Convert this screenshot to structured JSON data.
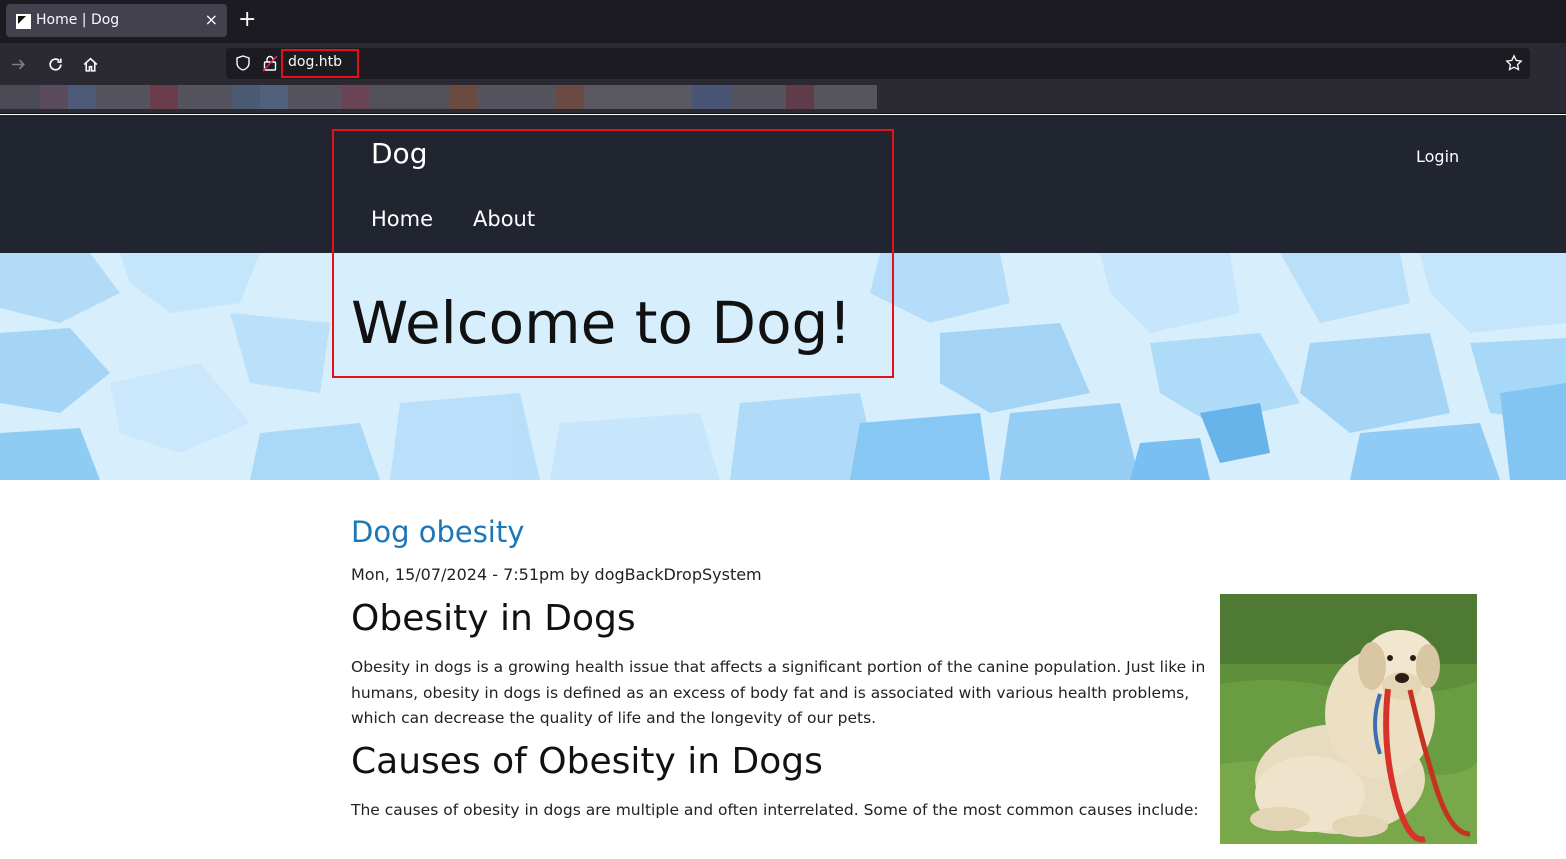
{
  "browser": {
    "tab_title": "Home | Dog",
    "tab_close": "×",
    "new_tab": "+",
    "url": "dog.htb"
  },
  "site": {
    "name": "Dog",
    "nav": {
      "home": "Home",
      "about": "About"
    },
    "login": "Login"
  },
  "hero": {
    "title": "Welcome to Dog!"
  },
  "article": {
    "title": "Dog obesity",
    "meta": "Mon, 15/07/2024 - 7:51pm by dogBackDropSystem",
    "sections": [
      {
        "heading": "Obesity in Dogs",
        "text": "Obesity in dogs is a growing health issue that affects a significant portion of the canine population. Just like in humans, obesity in dogs is defined as an excess of body fat and is associated with various health problems, which can decrease the quality of life and the longevity of our pets."
      },
      {
        "heading": "Causes of Obesity in Dogs",
        "text": "The causes of obesity in dogs are multiple and often interrelated. Some of the most common causes include:"
      }
    ]
  },
  "colors": {
    "browser_bg": "#1c1b22",
    "toolbar_bg": "#2b2a33",
    "site_header_bg": "#212530",
    "hero_bg": "#d3ecfb",
    "link_blue": "#1b77b8",
    "highlight_red": "#e4101a"
  },
  "icons": [
    "forward-icon",
    "reload-icon",
    "home-icon",
    "shield-icon",
    "lock-icon",
    "star-icon",
    "close-icon",
    "plus-icon"
  ]
}
